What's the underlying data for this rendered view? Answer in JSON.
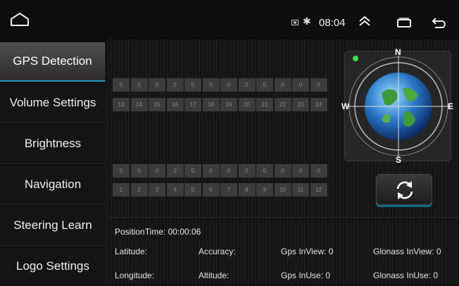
{
  "status": {
    "time": "08:04"
  },
  "icons": {
    "home": "home-icon",
    "sim": "sim-card-icon",
    "bluetooth": "bluetooth-icon",
    "up": "chevron-up-icon",
    "recents": "recents-icon",
    "back": "back-icon",
    "refresh": "refresh-icon"
  },
  "sidebar": {
    "items": [
      {
        "label": "GPS Detection",
        "active": true
      },
      {
        "label": "Volume Settings"
      },
      {
        "label": "Brightness"
      },
      {
        "label": "Navigation"
      },
      {
        "label": "Steering Learn"
      },
      {
        "label": "Logo Settings"
      }
    ]
  },
  "satellites": {
    "top_values": [
      "0",
      "0",
      "0",
      "0",
      "0",
      "0",
      "0",
      "0",
      "0",
      "0",
      "0",
      "0"
    ],
    "top_ids": [
      "13",
      "14",
      "15",
      "16",
      "17",
      "18",
      "19",
      "20",
      "21",
      "22",
      "23",
      "24"
    ],
    "bottom_values": [
      "0",
      "0",
      "0",
      "0",
      "0",
      "0",
      "0",
      "0",
      "0",
      "0",
      "0",
      "0"
    ],
    "bottom_ids": [
      "1",
      "2",
      "3",
      "4",
      "5",
      "6",
      "7",
      "8",
      "9",
      "10",
      "11",
      "12"
    ]
  },
  "compass": {
    "n": "N",
    "s": "S",
    "w": "W",
    "e": "E"
  },
  "info": {
    "position_time": "PositionTime: 00:00:06",
    "latitude": "Latitude:",
    "longitude": "Longitude:",
    "accuracy": "Accuracy:",
    "altitude": "Altitude:",
    "gps_inview": "Gps InView: 0",
    "gps_inuse": "Gps InUse: 0",
    "glonass_inview": "Glonass InView: 0",
    "glonass_inuse": "Glonass InUse: 0"
  },
  "colors": {
    "accent": "#1fa2c8",
    "background": "#111111",
    "cell": "#3c3c3c"
  }
}
